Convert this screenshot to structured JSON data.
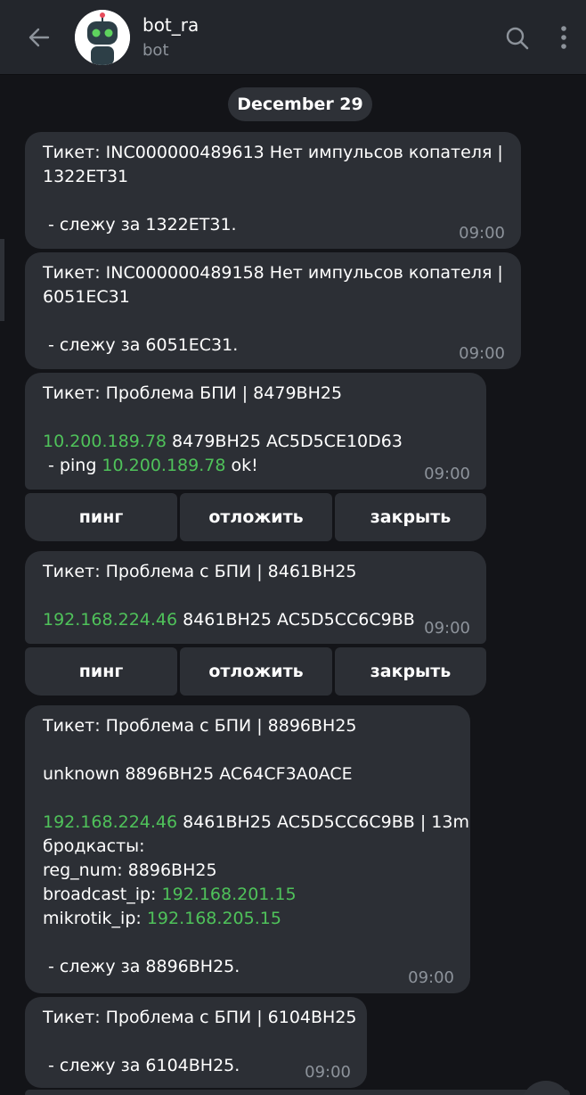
{
  "header": {
    "title": "bot_ra",
    "subtitle": "bot"
  },
  "date_separator": "December 29",
  "messages": [
    {
      "ticket": "Тикет: INC000000489613 Нет импульсов копателя |",
      "ticket_cont": "1322ET31",
      "watch": " - слежу за 1322ET31.",
      "time": "09:00"
    },
    {
      "ticket": "Тикет: INC000000489158 Нет импульсов копателя |",
      "ticket_cont": "6051EC31",
      "watch": " - слежу за 6051EC31.",
      "time": "09:00"
    },
    {
      "ticket": "Тикет: Проблема БПИ | 8479BH25",
      "ip": "10.200.189.78",
      "info": " 8479BH25 AC5D5CE10D63",
      "ping_prefix": " - ping ",
      "ping_ip": "10.200.189.78",
      "ping_suffix": " ok!",
      "time": "09:00"
    },
    {
      "ticket": "Тикет: Проблема с БПИ | 8461BH25",
      "ip": "192.168.224.46",
      "info": " 8461BH25 AC5D5CC6C9BB",
      "time": "09:00"
    },
    {
      "ticket": "Тикет: Проблема с БПИ | 8896BH25",
      "unknown": "unknown 8896BH25 AC64CF3A0ACE",
      "ip": "192.168.224.46",
      "info": " 8461BH25 AC5D5CC6C9BB | 13m",
      "broadcasts": "бродкасты:",
      "reg_num": "reg_num: 8896BH25",
      "broadcast_label": "broadcast_ip: ",
      "broadcast_ip": "192.168.201.15",
      "mikrotik_label": "mikrotik_ip: ",
      "mikrotik_ip": "192.168.205.15",
      "watch": " - слежу за 8896BH25.",
      "time": "09:00"
    },
    {
      "ticket": "Тикет: Проблема с БПИ | 6104BH25",
      "watch": " - слежу за 6104BH25.",
      "time": "09:00"
    }
  ],
  "keyboards": [
    {
      "ping": "пинг",
      "postpone": "отложить",
      "close": "закрыть"
    },
    {
      "ping": "пинг",
      "postpone": "отложить",
      "close": "закрыть"
    }
  ],
  "colors": {
    "ip_green": "#4fc25a",
    "bubble_bg": "#2c2f35",
    "background": "#131418",
    "header_bg": "#23262c"
  },
  "icons": [
    "back-arrow-icon",
    "bot-avatar",
    "search-icon",
    "more-vertical-icon"
  ]
}
